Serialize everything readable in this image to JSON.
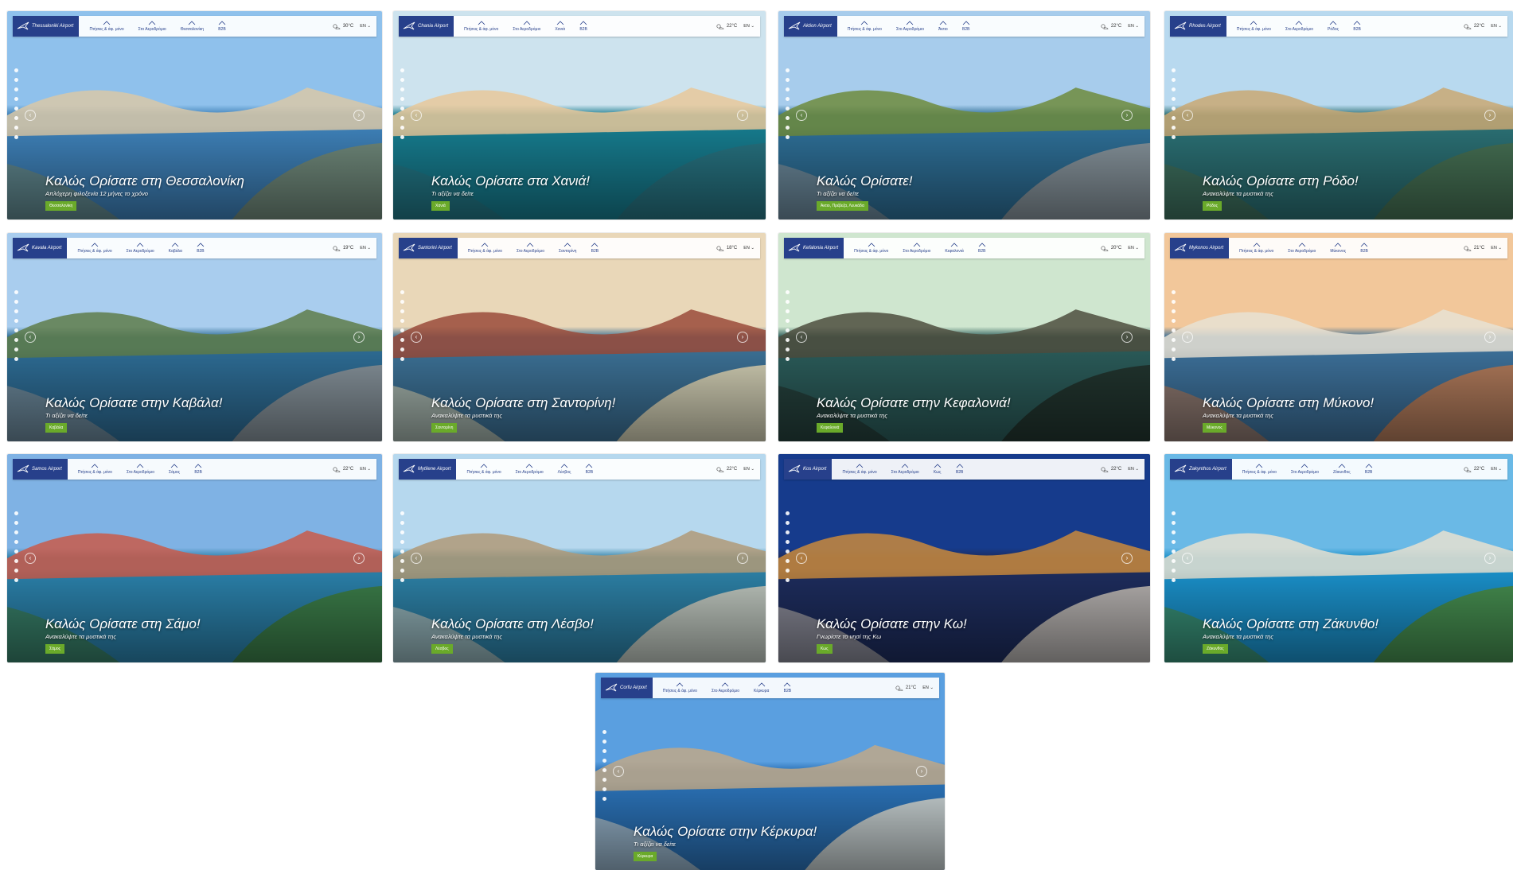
{
  "nav_labels": [
    "Πτήσεις & άφ. μόνο",
    "Στο Αεροδρόμιο",
    "B2B"
  ],
  "colors": {
    "header_blue": "#27408b",
    "badge_green": "#6aaa2a"
  },
  "icons": {
    "plane": "plane-logo-icon",
    "weather": "weather-icon",
    "arrow_left": "‹",
    "arrow_right": "›"
  },
  "tiles": [
    {
      "airport": "Thessaloniki Airport",
      "city": "Θεσσαλονίκη",
      "temp": "30°C",
      "lang": "EN",
      "title": "Καλώς Ορίσατε στη Θεσσαλονίκη",
      "subtitle": "Απλόχερη φιλοξενία 12 μήνες το χρόνο",
      "badge": "Θεσσαλονίκη"
    },
    {
      "airport": "Chania Airport",
      "city": "Χανιά",
      "temp": "22°C",
      "lang": "EN",
      "title": "Καλώς Ορίσατε στα Χανιά!",
      "subtitle": "Τι αξίζει να δείτε",
      "badge": "Χανιά"
    },
    {
      "airport": "Aktion Airport",
      "city": "Άκτιο",
      "temp": "22°C",
      "lang": "EN",
      "title": "Καλώς Ορίσατε!",
      "subtitle": "Τι αξίζει να δείτε",
      "badge": "Άκτιο, Πρέβεζα, Λευκάδα"
    },
    {
      "airport": "Rhodes Airport",
      "city": "Ρόδος",
      "temp": "22°C",
      "lang": "EN",
      "title": "Καλώς Ορίσατε στη Ρόδο!",
      "subtitle": "Ανακαλύψτε τα μυστικά της",
      "badge": "Ρόδος"
    },
    {
      "airport": "Kavala Airport",
      "city": "Καβάλα",
      "temp": "19°C",
      "lang": "EN",
      "title": "Καλώς Ορίσατε στην Καβάλα!",
      "subtitle": "Τι αξίζει να δείτε",
      "badge": "Καβάλα"
    },
    {
      "airport": "Santorini Airport",
      "city": "Σαντορίνη",
      "temp": "18°C",
      "lang": "EN",
      "title": "Καλώς Ορίσατε στη Σαντορίνη!",
      "subtitle": "Ανακαλύψτε τα μυστικά της",
      "badge": "Σαντορίνη"
    },
    {
      "airport": "Kefalonia Airport",
      "city": "Κεφαλονιά",
      "temp": "20°C",
      "lang": "EN",
      "title": "Καλώς Ορίσατε στην Κεφαλονιά!",
      "subtitle": "Ανακαλύψτε τα μυστικά της",
      "badge": "Κεφαλονιά"
    },
    {
      "airport": "Mykonos Airport",
      "city": "Μύκονος",
      "temp": "21°C",
      "lang": "EN",
      "title": "Καλώς Ορίσατε στη Μύκονο!",
      "subtitle": "Ανακαλύψτε τα μυστικά της",
      "badge": "Μύκονος"
    },
    {
      "airport": "Samos Airport",
      "city": "Σάμος",
      "temp": "22°C",
      "lang": "EN",
      "title": "Καλώς Ορίσατε στη Σάμο!",
      "subtitle": "Ανακαλύψτε τα μυστικά της",
      "badge": "Σάμος"
    },
    {
      "airport": "Mytilene Airport",
      "city": "Λέσβος",
      "temp": "22°C",
      "lang": "EN",
      "title": "Καλώς Ορίσατε στη Λέσβο!",
      "subtitle": "Ανακαλύψτε τα μυστικά της",
      "badge": "Λέσβος"
    },
    {
      "airport": "Kos Airport",
      "city": "Κως",
      "temp": "22°C",
      "lang": "EN",
      "title": "Καλώς Ορίσατε στην Κω!",
      "subtitle": "Γνωρίστε το νησί της Κω",
      "badge": "Κως"
    },
    {
      "airport": "Zakynthos Airport",
      "city": "Ζάκυνθος",
      "temp": "22°C",
      "lang": "EN",
      "title": "Καλώς Ορίσατε στη Ζάκυνθο!",
      "subtitle": "Ανακαλύψτε τα μυστικά της",
      "badge": "Ζάκυνθος"
    },
    {
      "airport": "Corfu Airport",
      "city": "Κέρκυρα",
      "temp": "21°C",
      "lang": "EN",
      "title": "Καλώς Ορίσατε στην Κέρκυρα!",
      "subtitle": "Τι αξίζει να δείτε",
      "badge": "Κέρκυρα"
    }
  ]
}
